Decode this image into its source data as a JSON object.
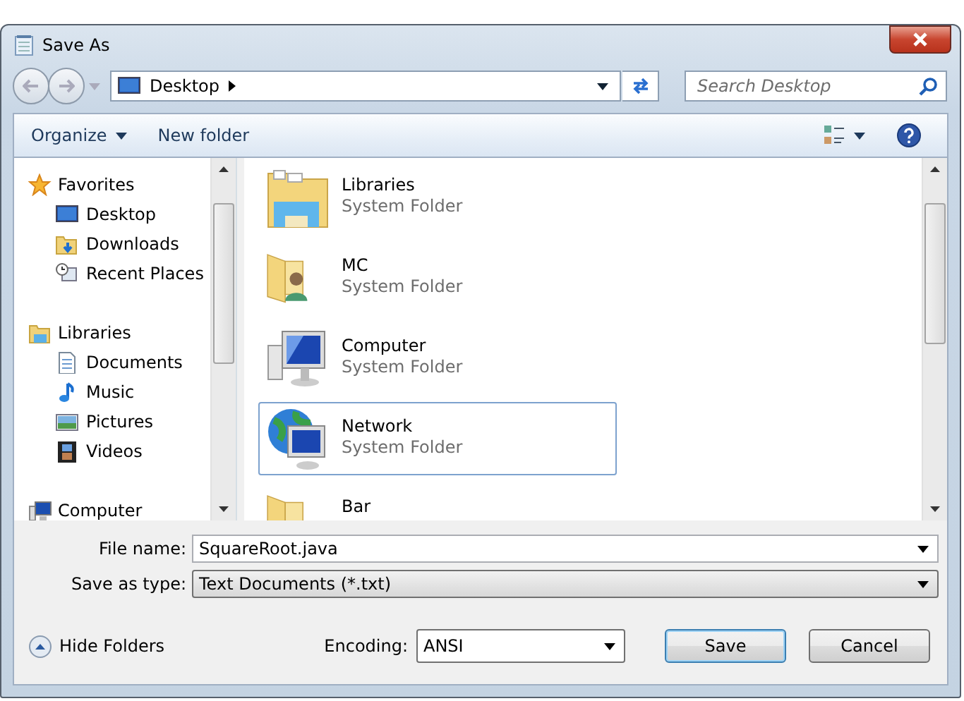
{
  "window": {
    "title": "Save As"
  },
  "address": {
    "location": "Desktop",
    "search_placeholder": "Search Desktop"
  },
  "toolbar": {
    "organize": "Organize",
    "new_folder": "New folder"
  },
  "sidebar": {
    "groups": [
      {
        "label": "Favorites",
        "children": [
          {
            "label": "Desktop"
          },
          {
            "label": "Downloads"
          },
          {
            "label": "Recent Places"
          }
        ]
      },
      {
        "label": "Libraries",
        "children": [
          {
            "label": "Documents"
          },
          {
            "label": "Music"
          },
          {
            "label": "Pictures"
          },
          {
            "label": "Videos"
          }
        ]
      },
      {
        "label": "Computer"
      }
    ]
  },
  "items": [
    {
      "name": "Libraries",
      "type": "System Folder",
      "selected": false
    },
    {
      "name": "MC",
      "type": "System Folder",
      "selected": false
    },
    {
      "name": "Computer",
      "type": "System Folder",
      "selected": false
    },
    {
      "name": "Network",
      "type": "System Folder",
      "selected": true
    },
    {
      "name": "Bar",
      "selected": false
    }
  ],
  "form": {
    "file_name_label": "File name:",
    "file_name": "SquareRoot.java",
    "type_label": "Save as type:",
    "type": "Text Documents (*.txt)"
  },
  "footer": {
    "hide_folders": "Hide Folders",
    "encoding_label": "Encoding:",
    "encoding": "ANSI",
    "buttons": [
      "Save",
      "Cancel"
    ]
  }
}
